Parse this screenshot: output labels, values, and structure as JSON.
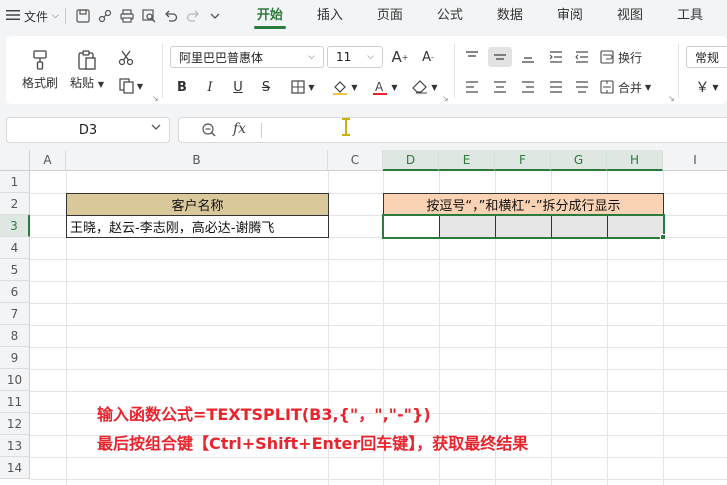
{
  "menubar": {
    "file_label": "文件",
    "tabs": [
      {
        "label": "开始",
        "active": true
      },
      {
        "label": "插入",
        "active": false
      },
      {
        "label": "页面",
        "active": false
      },
      {
        "label": "公式",
        "active": false
      },
      {
        "label": "数据",
        "active": false
      },
      {
        "label": "审阅",
        "active": false
      },
      {
        "label": "视图",
        "active": false
      },
      {
        "label": "工具",
        "active": false
      }
    ]
  },
  "ribbon": {
    "format_painter": "格式刷",
    "paste": "粘贴",
    "font_name": "阿里巴巴普惠体",
    "font_size": "11",
    "wrap_text": "换行",
    "merge": "合并",
    "number_format": "常规"
  },
  "formula_bar": {
    "name_box": "D3",
    "fx_label": "fx",
    "formula": ""
  },
  "sheet": {
    "columns": [
      "A",
      "B",
      "C",
      "D",
      "E",
      "F",
      "G",
      "H",
      "I"
    ],
    "rows": [
      "1",
      "2",
      "3",
      "4",
      "5",
      "6",
      "7",
      "8",
      "9",
      "10",
      "11",
      "12",
      "13",
      "14"
    ],
    "selected_cell": "D3",
    "b2": "客户名称",
    "b3": "王晓，赵云-李志刚，高必达-谢腾飞",
    "d2": "按逗号“，”和横杠“-”拆分成行显示"
  },
  "annotation": {
    "line1": "输入函数公式=TEXTSPLIT(B3,{\"，\",\"-\"})",
    "line2": "最后按组合键【Ctrl+Shift+Enter回车键】，获取最终结果"
  },
  "colors": {
    "accent_green": "#2c7a3c",
    "header_tan": "#d8c89a",
    "header_peach": "#f9d3b3",
    "note_red": "#e8252d"
  }
}
